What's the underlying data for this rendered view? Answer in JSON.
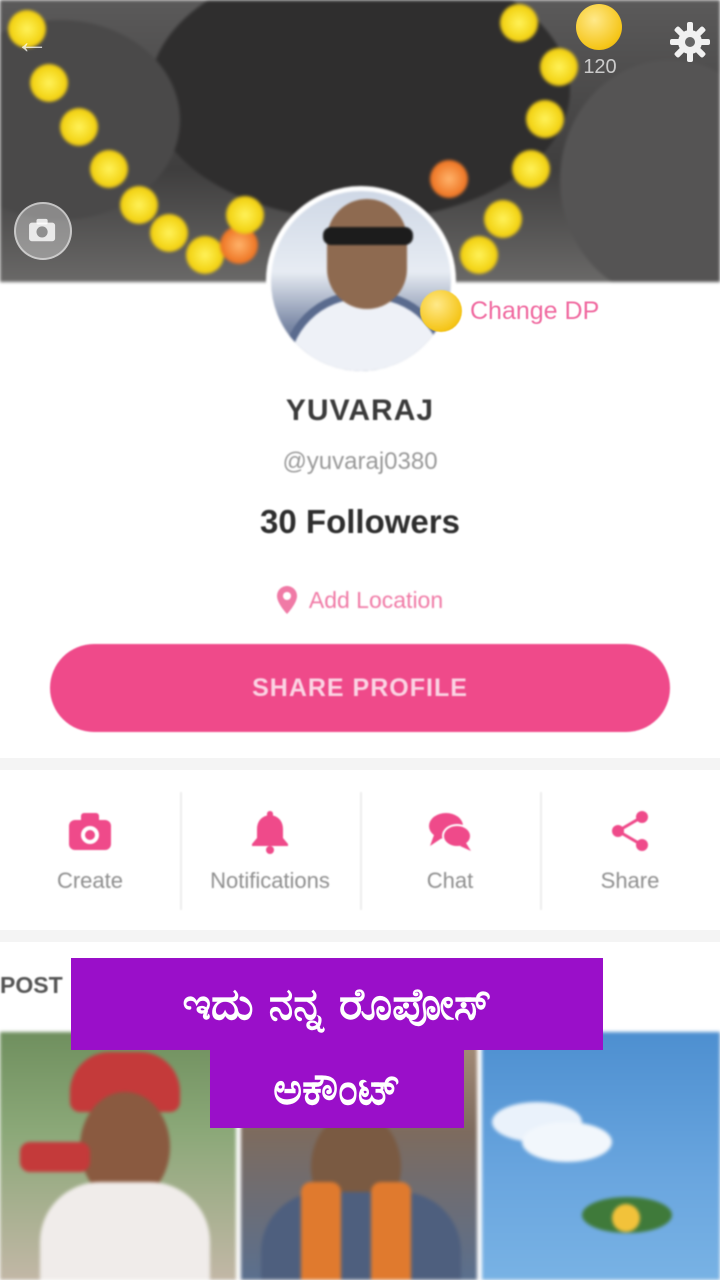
{
  "header": {
    "back_icon": "arrow-left-icon",
    "settings_icon": "gear-icon",
    "coin_count": "120",
    "camera_icon": "camera-icon"
  },
  "profile": {
    "change_dp_label": "Change DP",
    "name": "YUVARAJ",
    "handle": "@yuvaraj0380",
    "followers": "30 Followers",
    "location_label": "Add Location",
    "share_button": "SHARE PROFILE"
  },
  "actions": [
    {
      "label": "Create",
      "icon": "camera-icon"
    },
    {
      "label": "Notifications",
      "icon": "bell-icon"
    },
    {
      "label": "Chat",
      "icon": "chat-icon"
    },
    {
      "label": "Share",
      "icon": "share-icon"
    }
  ],
  "posts": {
    "section_label": "POST"
  },
  "overlay_caption": {
    "line1": "ಇದು ನನ್ನ ರೊಪೋಸ್",
    "line2": "ಅಕೌಂಟ್"
  },
  "colors": {
    "accent": "#ef4a8a",
    "caption_bg": "#9a0fc9"
  }
}
